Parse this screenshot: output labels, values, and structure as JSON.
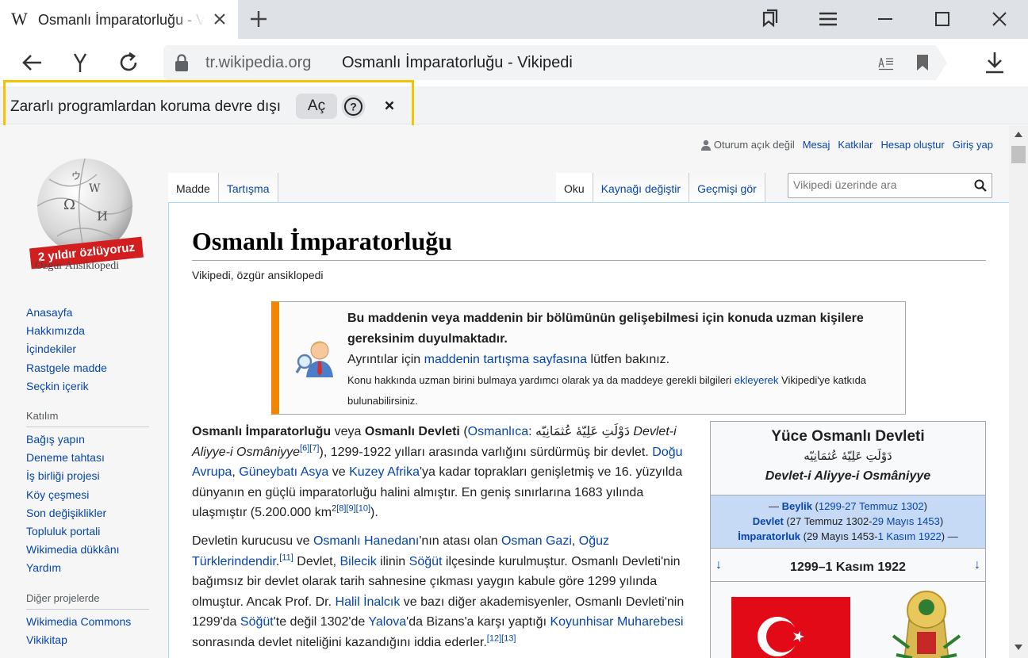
{
  "browser": {
    "tab": {
      "favicon": "W",
      "title": "Osmanlı İmparatorluğu - Vikipedi"
    },
    "address": {
      "domain": "tr.wikipedia.org",
      "page_title": "Osmanlı İmparatorluğu - Vikipedi"
    },
    "icons": [
      "close-icon",
      "plus-icon",
      "bookmarks-panel-icon",
      "menu-icon",
      "minimize-icon",
      "maximize-icon",
      "back-icon",
      "yandex-icon",
      "reload-icon",
      "lock-icon",
      "reader-mode-icon",
      "bookmark-icon",
      "download-icon"
    ]
  },
  "infobar": {
    "message": "Zararlı programlardan koruma devre dışı",
    "open_label": "Aç",
    "help_label": "?",
    "close_label": "×"
  },
  "wiki": {
    "logo": {
      "banner": "2 yıldır özlüyoruz",
      "subtitle": "Özgür Ansiklopedi"
    },
    "personal": {
      "user": "Oturum açık değil",
      "links": [
        "Mesaj",
        "Katkılar",
        "Hesap oluştur",
        "Giriş yap"
      ]
    },
    "tabs_left": [
      "Madde",
      "Tartışma"
    ],
    "tabs_right": [
      "Oku",
      "Kaynağı değiştir",
      "Geçmişi gör"
    ],
    "search_placeholder": "Vikipedi üzerinde ara",
    "sidebar": {
      "nav": [
        "Anasayfa",
        "Hakkımızda",
        "İçindekiler",
        "Rastgele madde",
        "Seçkin içerik"
      ],
      "participation_heading": "Katılım",
      "participation": [
        "Bağış yapın",
        "Deneme tahtası",
        "İş birliği projesi",
        "Köy çeşmesi",
        "Son değişiklikler",
        "Topluluk portali",
        "Wikimedia dükkânı",
        "Yardım"
      ],
      "other_heading": "Diğer projelerde",
      "other": [
        "Wikimedia Commons",
        "Vikikitap"
      ]
    },
    "heading": "Osmanlı İmparatorluğu",
    "site_sub": "Vikipedi, özgür ansiklopedi",
    "ambox": {
      "title": "Bu maddenin veya maddenin bir bölümünün gelişebilmesi için konuda uzman kişilere gereksinim duyulmaktadır.",
      "line2_pre": "Ayrıntılar için ",
      "line2_link": "maddenin tartışma sayfasına",
      "line2_post": " lütfen bakınız.",
      "line3_pre": "Konu hakkında uzman birini bulmaya yardımcı olarak ya da maddeye gerekli bilgileri ",
      "line3_link": "ekleyerek",
      "line3_post": " Vikipedi'ye katkıda bulunabilirsiniz."
    },
    "para1": {
      "b1": "Osmanlı İmparatorluğu",
      "t1": " veya ",
      "b2": "Osmanlı Devleti",
      "t2": " (",
      "l1": "Osmanlıca",
      "t3": ": دَوْلَتِ عَلِيّهٔ عُثمَانِيّه ",
      "i1": "Devlet-i Aliyye-i Osmâniyye",
      "s1": "[6][7]",
      "t4": "), 1299-1922 yılları arasında varlığını sürdürmüş bir devlet. ",
      "l2": "Doğu Avrupa",
      "t5": ", ",
      "l3": "Güneybatı Asya",
      "t6": " ve ",
      "l4": "Kuzey Afrika",
      "t7": "'ya kadar toprakları genişletmiş ve 16. yüzyılda dünyanın en güçlü imparatorluğu halini almıştır. En geniş sınırlarına 1683 yılında ulaşmıştır (5.200.000 km",
      "s2": "2",
      "s3": "[8][9][10]",
      "t8": ")."
    },
    "para2": {
      "t1": "Devletin kurucusu ve ",
      "l1": "Osmanlı Hanedanı",
      "t2": "'nın atası olan ",
      "l2": "Osman Gazi",
      "t3": ", ",
      "l3": "Oğuz Türklerindendir",
      "t4": ".",
      "s1": "[11]",
      "t5": " Devlet, ",
      "l4": "Bilecik",
      "t6": " ilinin ",
      "l5": "Söğüt",
      "t7": " ilçesinde kurulmuştur. Osmanlı Devleti'nin bağımsız bir devlet olarak tarih sahnesine çıkması yaygın kabule göre 1299 yılında olmuştur. Ancak Prof. Dr. ",
      "l6": "Halil İnalcık",
      "t8": " ve bazı diğer akademisyenler, Osmanlı Devleti'nin 1299'da ",
      "l7": "Söğüt",
      "t9": "'te değil 1302'de ",
      "l8": "Yalova",
      "t10": "'da Bizans'a karşı yaptığı ",
      "l9": "Koyunhisar Muharebesi",
      "t11": " sonrasında devlet niteliğini kazandığını iddia ederler.",
      "s2": "[12][13]"
    },
    "infobox": {
      "title": "Yüce Osmanlı Devleti",
      "arabic": "دَوْلَتِ عَلِيّهٔ عُثمَانِيّه",
      "native": "Devlet-i Aliyye-i Osmâniyye",
      "row1": {
        "prefix": "— ",
        "name": "Beylik",
        "open": " (",
        "range": "1299-27 Temmuz 1302",
        "close": ")"
      },
      "row2": {
        "name": "Devlet",
        "open": " (27 Temmuz 1302-",
        "range": "29 Mayıs 1453",
        "close": ")"
      },
      "row3": {
        "name": "İmparatorluk",
        "open": " (29 Mayıs 1453-",
        "range": "1 Kasım 1922",
        "close": ") —"
      },
      "period": "1299–1 Kasım 1922",
      "arrow_left": "↓",
      "arrow_right": "↓"
    }
  },
  "colors": {
    "highlight": "#f5c400",
    "link": "#0645ad",
    "ambox_accent": "#f28500",
    "flag_red": "#e30a17",
    "infobox_band": "#c6d9f5"
  }
}
